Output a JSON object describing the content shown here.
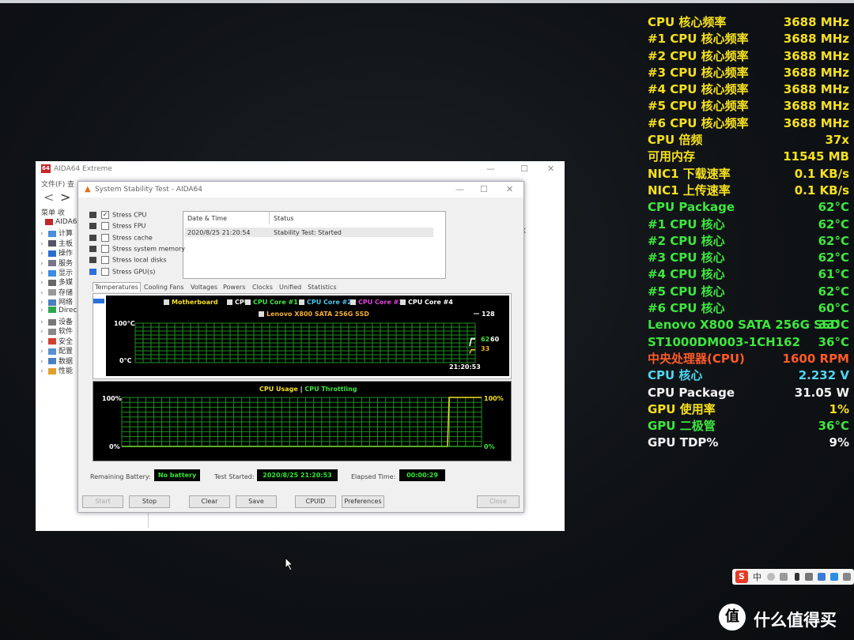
{
  "osd": [
    {
      "label": "CPU 核心频率",
      "value": "3688 MHz",
      "color": "#f5e01e"
    },
    {
      "label": "#1 CPU 核心频率",
      "value": "3688 MHz",
      "color": "#f5e01e"
    },
    {
      "label": "#2 CPU 核心频率",
      "value": "3688 MHz",
      "color": "#f5e01e"
    },
    {
      "label": "#3 CPU 核心频率",
      "value": "3688 MHz",
      "color": "#f5e01e"
    },
    {
      "label": "#4 CPU 核心频率",
      "value": "3688 MHz",
      "color": "#f5e01e"
    },
    {
      "label": "#5 CPU 核心频率",
      "value": "3688 MHz",
      "color": "#f5e01e"
    },
    {
      "label": "#6 CPU 核心频率",
      "value": "3688 MHz",
      "color": "#f5e01e"
    },
    {
      "label": "CPU 倍频",
      "value": "37x",
      "color": "#f5e01e"
    },
    {
      "label": "可用内存",
      "value": "11545 MB",
      "color": "#f5e01e"
    },
    {
      "label": "NIC1 下载速率",
      "value": "0.1 KB/s",
      "color": "#f5e01e"
    },
    {
      "label": "NIC1 上传速率",
      "value": "0.1 KB/s",
      "color": "#f5e01e"
    },
    {
      "label": "CPU Package",
      "value": "62°C",
      "color": "#3ee63e"
    },
    {
      "label": " #1 CPU 核心",
      "value": "62°C",
      "color": "#3ee63e"
    },
    {
      "label": " #2 CPU 核心",
      "value": "62°C",
      "color": "#3ee63e"
    },
    {
      "label": " #3 CPU 核心",
      "value": "62°C",
      "color": "#3ee63e"
    },
    {
      "label": " #4 CPU 核心",
      "value": "61°C",
      "color": "#3ee63e"
    },
    {
      "label": " #5 CPU 核心",
      "value": "62°C",
      "color": "#3ee63e"
    },
    {
      "label": " #6 CPU 核心",
      "value": "60°C",
      "color": "#3ee63e"
    },
    {
      "label": "Lenovo X800 SATA 256G SSD",
      "value": "33°C",
      "color": "#3ee63e"
    },
    {
      "label": "ST1000DM003-1CH162",
      "value": "36°C",
      "color": "#3ee63e"
    },
    {
      "label": "中央处理器(CPU)",
      "value": "1600 RPM",
      "color": "#ff5a28"
    },
    {
      "label": "CPU 核心",
      "value": "2.232 V",
      "color": "#4fd6f0"
    },
    {
      "label": "CPU Package",
      "value": "31.05 W",
      "color": "#f2f2f2"
    },
    {
      "label": "GPU 使用率",
      "value": "1%",
      "color": "#f5e01e"
    },
    {
      "label": "GPU 二极管",
      "value": "36°C",
      "color": "#3ee63e"
    },
    {
      "label": "GPU TDP%",
      "value": "9%",
      "color": "#f2f2f2"
    }
  ],
  "main_window": {
    "logo": "64",
    "title": "AIDA64 Extreme",
    "menu": "文件(F)   查",
    "tabs_left": "菜单    收",
    "tree": [
      {
        "label": "AIDA64",
        "color": "#c3272b",
        "root": true
      },
      {
        "label": "计算",
        "color": "#4a8fd8"
      },
      {
        "label": "主板",
        "color": "#556"
      },
      {
        "label": "操作",
        "color": "#2a6fd0"
      },
      {
        "label": "服务",
        "color": "#778"
      },
      {
        "label": "显示",
        "color": "#3c8be0"
      },
      {
        "label": "多媒",
        "color": "#666"
      },
      {
        "label": "存储",
        "color": "#999"
      },
      {
        "label": "网络",
        "color": "#4a7fc0"
      },
      {
        "label": "Direc",
        "color": "#2fa84f"
      },
      {
        "label": "设备",
        "color": "#777"
      },
      {
        "label": "软件",
        "color": "#888"
      },
      {
        "label": "安全",
        "color": "#d04030"
      },
      {
        "label": "配置",
        "color": "#5a8fd0"
      },
      {
        "label": "数据",
        "color": "#4a7fc0"
      },
      {
        "label": "性能",
        "color": "#e0a030"
      }
    ]
  },
  "sst": {
    "title": "System Stability Test - AIDA64",
    "checks": [
      {
        "label": "Stress CPU",
        "checked": true
      },
      {
        "label": "Stress FPU",
        "checked": false
      },
      {
        "label": "Stress cache",
        "checked": false
      },
      {
        "label": "Stress system memory",
        "checked": false
      },
      {
        "label": "Stress local disks",
        "checked": false
      },
      {
        "label": "Stress GPU(s)",
        "checked": false
      }
    ],
    "log_headers": {
      "date": "Date & Time",
      "status": "Status"
    },
    "log_row": {
      "date": "2020/8/25 21:20:54",
      "status": "Stability Test: Started"
    },
    "tabs": [
      "Temperatures",
      "Cooling Fans",
      "Voltages",
      "Powers",
      "Clocks",
      "Unified",
      "Statistics"
    ],
    "temp_graph": {
      "legend": [
        {
          "label": "Motherboard",
          "color": "#f5e01e"
        },
        {
          "label": "CPU",
          "color": "#ffffff"
        },
        {
          "label": "CPU Core #1",
          "color": "#3ee63e"
        },
        {
          "label": "CPU Core #2",
          "color": "#4fc6f0"
        },
        {
          "label": "CPU Core #3",
          "color": "#e040e0"
        },
        {
          "label": "CPU Core #4",
          "color": "#ffffff"
        },
        {
          "label": "Lenovo X800 SATA 256G SSD",
          "color": "#f5b030"
        }
      ],
      "ymax": "100°C",
      "ymin": "0°C",
      "time": "21:20:53",
      "right_values": {
        "top": "128",
        "a": "62",
        "b": "60",
        "c": "33"
      }
    },
    "usage_graph": {
      "title_a": "CPU Usage",
      "sep": " | ",
      "title_b": "CPU Throttling",
      "ymax_l": "100%",
      "ymin_l": "0%",
      "ymax_r": "100%",
      "ymin_r": "0%"
    },
    "status": {
      "battery_label": "Remaining Battery:",
      "battery": "No battery",
      "started_label": "Test Started:",
      "started": "2020/8/25 21:20:53",
      "elapsed_label": "Elapsed Time:",
      "elapsed": "00:00:29"
    },
    "buttons": {
      "start": "Start",
      "stop": "Stop",
      "clear": "Clear",
      "save": "Save",
      "cpuid": "CPUID",
      "prefs": "Preferences",
      "close": "Close"
    }
  },
  "tray": {
    "ime": "S",
    "ime_lang": "中",
    "watermark": "什么值得买",
    "wm_logo": "值"
  }
}
